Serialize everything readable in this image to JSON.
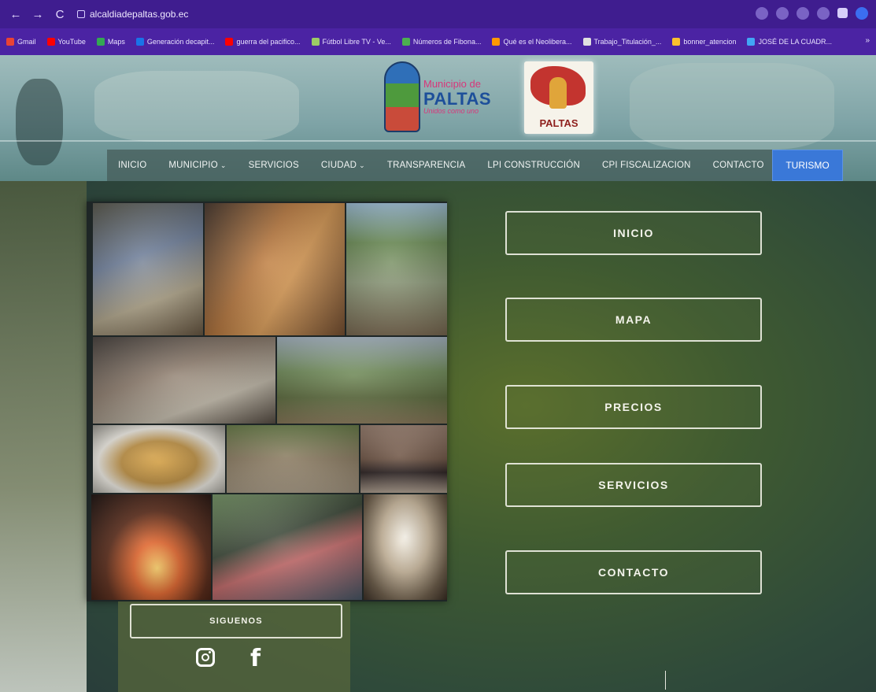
{
  "browser": {
    "url": "alcaldiadepaltas.gob.ec",
    "bookmarks": [
      {
        "label": "Gmail",
        "color": "#ea4335"
      },
      {
        "label": "YouTube",
        "color": "#ff0000"
      },
      {
        "label": "Maps",
        "color": "#34a853"
      },
      {
        "label": "Generación decapit...",
        "color": "#1a73e8"
      },
      {
        "label": "guerra del pacifico...",
        "color": "#ff0000"
      },
      {
        "label": "Fútbol Libre TV - Ve...",
        "color": "#9ccc65"
      },
      {
        "label": "Números de Fibona...",
        "color": "#4caf50"
      },
      {
        "label": "Qué es el Neolibera...",
        "color": "#ff9800"
      },
      {
        "label": "Trabajo_Titulación_...",
        "color": "#e0e0e0"
      },
      {
        "label": "bonner_atencion",
        "color": "#fbc02d"
      },
      {
        "label": "JOSÉ DE LA CUADR...",
        "color": "#42a5f5"
      }
    ],
    "more": "»"
  },
  "logo": {
    "line1": "Municipio de",
    "line2": "PALTAS",
    "tagline": "Unidos como uno",
    "badge": "PALTAS"
  },
  "nav": {
    "items": [
      {
        "label": "INICIO",
        "caret": ""
      },
      {
        "label": "MUNICIPIO",
        "caret": "⌄"
      },
      {
        "label": "SERVICIOS",
        "caret": ""
      },
      {
        "label": "CIUDAD",
        "caret": "⌄"
      },
      {
        "label": "TRANSPARENCIA",
        "caret": ""
      },
      {
        "label": "LPI CONSTRUCCIÓN",
        "caret": ""
      },
      {
        "label": "CPI FISCALIZACION",
        "caret": ""
      },
      {
        "label": "CONTACTO",
        "caret": ""
      }
    ],
    "turismo": "TURISMO"
  },
  "menu": {
    "inicio": "INICIO",
    "mapa": "MAPA",
    "precios": "PRECIOS",
    "servicios": "SERVICIOS",
    "contacto": "CONTACTO"
  },
  "follow": {
    "label": "SIGUENOS",
    "facebook_glyph": "f"
  },
  "colors": {
    "chrome": "#3f1d8f",
    "bookmarks_bar": "#4b23a3",
    "turismo": "#3a78d8"
  }
}
